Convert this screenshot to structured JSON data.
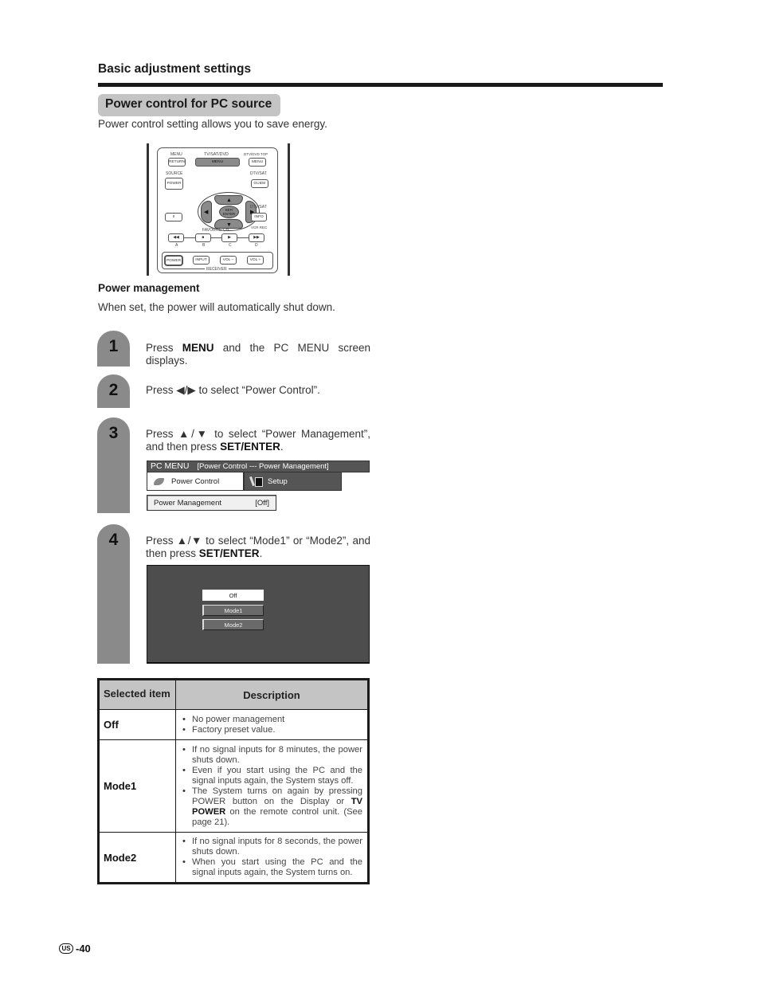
{
  "section": {
    "title": "Basic adjustment settings"
  },
  "subsection": {
    "title": "Power control for PC source",
    "intro": "Power control setting allows you to save energy."
  },
  "remote": {
    "labels": {
      "menu": "MENU",
      "tv_sat_dvd": "TV/SAT/DVD",
      "dtv_dvd_top": "DTV/DVD TOP",
      "source": "SOURCE",
      "dtv_sat_1": "DTV/SAT",
      "dtv_sat_2": "DTV/SAT",
      "favorite_ch": "FAVORITE CH",
      "vcr_rec": "VCR REC",
      "a": "A",
      "b": "B",
      "c": "C",
      "d": "D",
      "receiver": "RECEIVER"
    },
    "buttons": {
      "return": "RETURN",
      "menu_main": "MENU",
      "menu_top": "MENU",
      "power_source": "POWER",
      "guide": "GUIDE",
      "set_enter": "SET/ ENTER",
      "pause": "II",
      "info": "INFO",
      "rewind": "◀◀",
      "stop": "■",
      "play": "▶",
      "ffwd": "▶▶",
      "power_receiver": "POWER",
      "input": "INPUT",
      "vol_minus": "VOL –",
      "vol_plus": "VOL +"
    },
    "dpad": {
      "up": "▲",
      "down": "▼",
      "left": "◀",
      "right": "▶"
    }
  },
  "power_management": {
    "title": "Power management",
    "description": "When set, the power will automatically shut down."
  },
  "steps": [
    {
      "number": "1",
      "pre": "Press ",
      "bold": "MENU",
      "post": " and the PC MENU screen displays."
    },
    {
      "number": "2",
      "text": "Press ◀/▶ to select “Power Control”."
    },
    {
      "number": "3",
      "pre": "Press ▲/▼ to select “Power Management”, and then press ",
      "bold": "SET/ENTER",
      "post": "."
    },
    {
      "number": "4",
      "pre": "Press ▲/▼ to select “Mode1” or “Mode2”, and then press ",
      "bold": "SET/ENTER",
      "post": "."
    }
  ],
  "pc_menu": {
    "title": "PC MENU",
    "breadcrumb": "[Power Control --- Power Management]",
    "tabs": [
      {
        "label": "Power Control",
        "icon": "leaf-icon",
        "active": true
      },
      {
        "label": "Setup",
        "icon": "tool-icon",
        "active": false
      }
    ],
    "item": {
      "label": "Power Management",
      "value": "[Off]"
    }
  },
  "mode_options": [
    {
      "label": "Off",
      "selected": true
    },
    {
      "label": "Mode1",
      "selected": false
    },
    {
      "label": "Mode2",
      "selected": false
    }
  ],
  "table": {
    "headers": [
      "Selected item",
      "Description"
    ],
    "rows": [
      {
        "item": "Off",
        "bullets": [
          "No power management",
          "Factory preset value."
        ]
      },
      {
        "item": "Mode1",
        "bullets": [
          "If no signal inputs for 8 minutes, the power shuts down.",
          "Even if you start using the PC and the signal inputs again, the System stays off."
        ],
        "bullet3": {
          "pre": "The System turns on again by pressing POWER button on the Display or ",
          "bold": "TV POWER",
          "post": " on the remote control unit. (See page 21)."
        }
      },
      {
        "item": "Mode2",
        "bullets": [
          "If no signal inputs for 8 seconds, the power shuts down.",
          "When you start using the PC and the signal inputs again, the System turns on."
        ]
      }
    ]
  },
  "footer": {
    "region_badge": "US",
    "page": "-40"
  }
}
